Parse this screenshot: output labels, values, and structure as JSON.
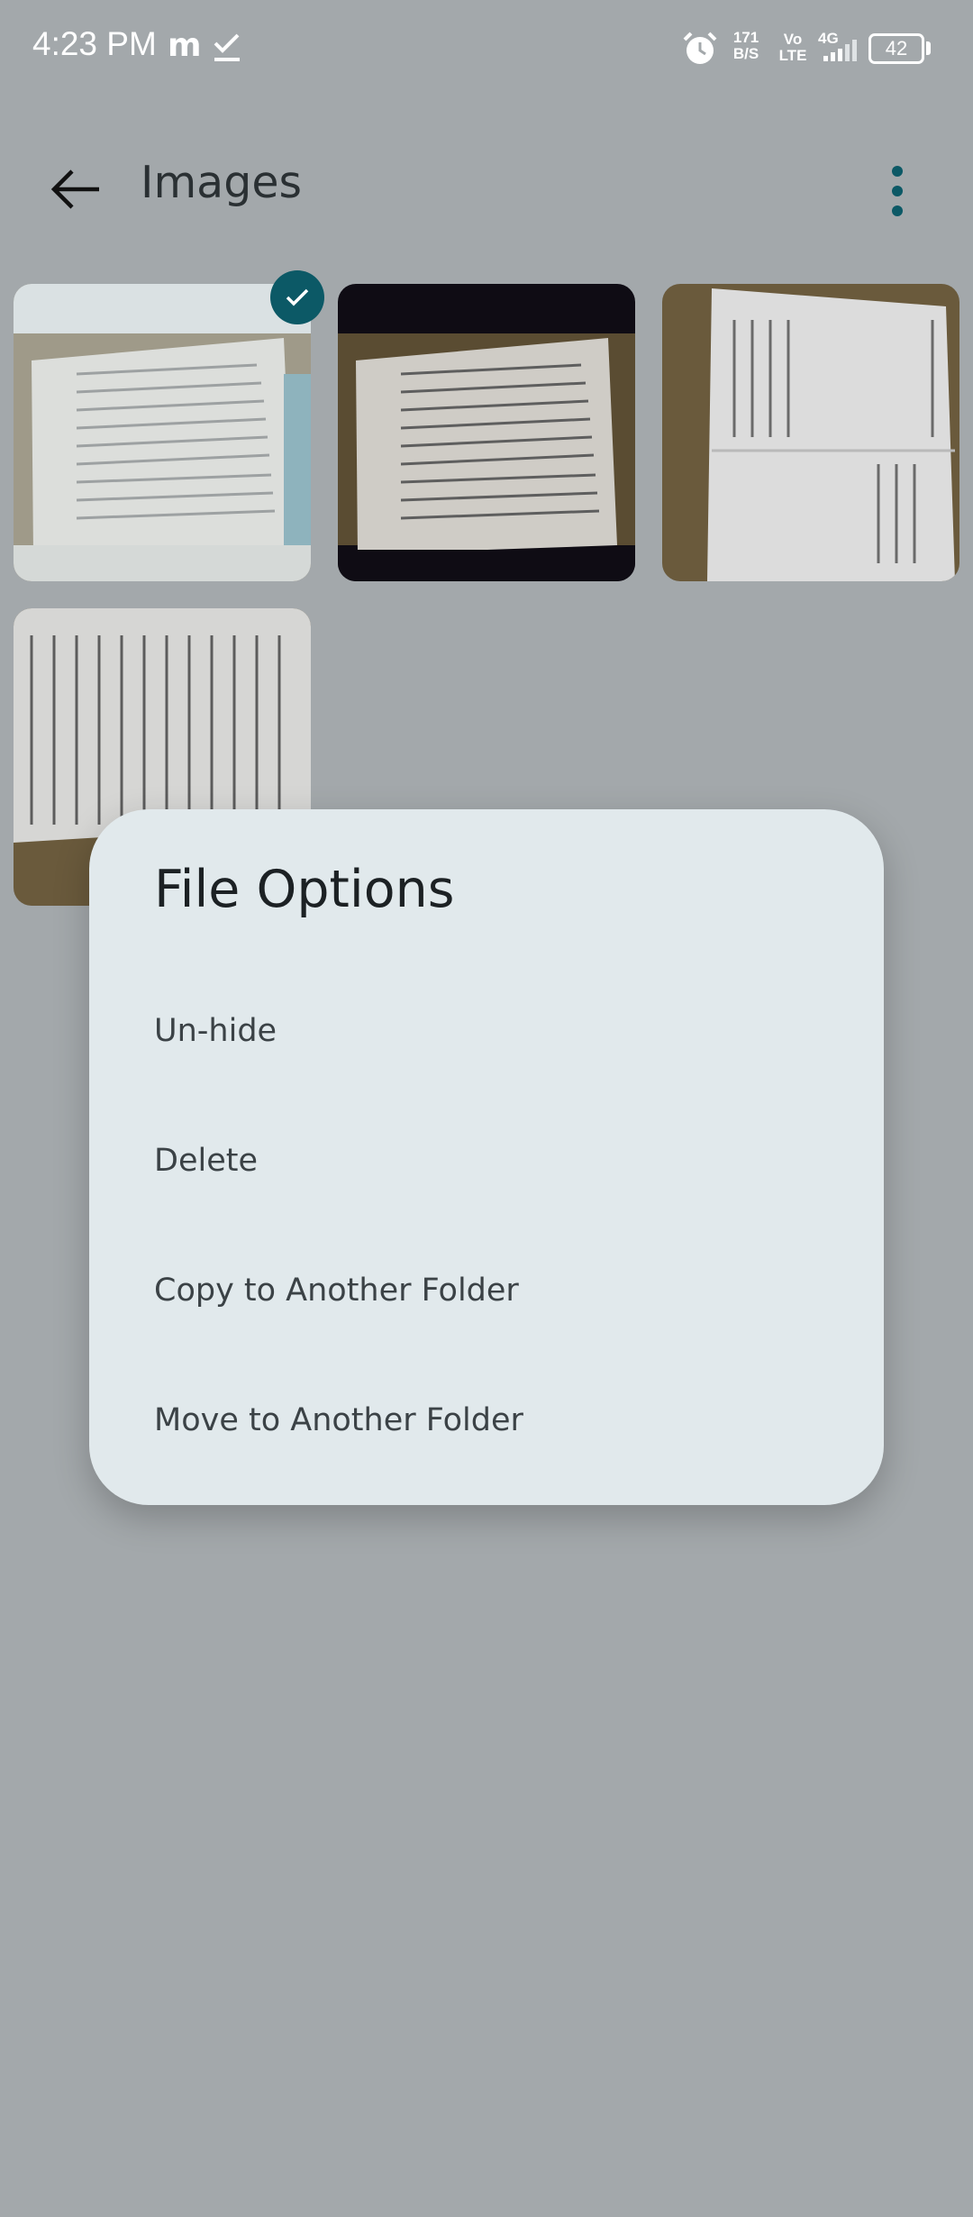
{
  "status_bar": {
    "time": "4:23 PM",
    "app_letter": "m",
    "net_speed_value": "171",
    "net_speed_unit": "B/S",
    "volte_top": "Vo",
    "volte_bottom": "LTE",
    "network": "4G",
    "battery": "42"
  },
  "app_bar": {
    "title": "Images",
    "back_icon": "arrow-left-icon",
    "menu_icon": "more-vertical-icon"
  },
  "grid": {
    "images": [
      {
        "selected": true
      },
      {
        "selected": false
      },
      {
        "selected": false
      },
      {
        "selected": false
      }
    ]
  },
  "dialog": {
    "title": "File Options",
    "options": [
      "Un-hide",
      "Delete",
      "Copy to Another Folder",
      "Move to Another Folder"
    ]
  },
  "colors": {
    "background": "#a3a8ab",
    "accent": "#0c5966",
    "dialog": "#e1e9ec"
  }
}
